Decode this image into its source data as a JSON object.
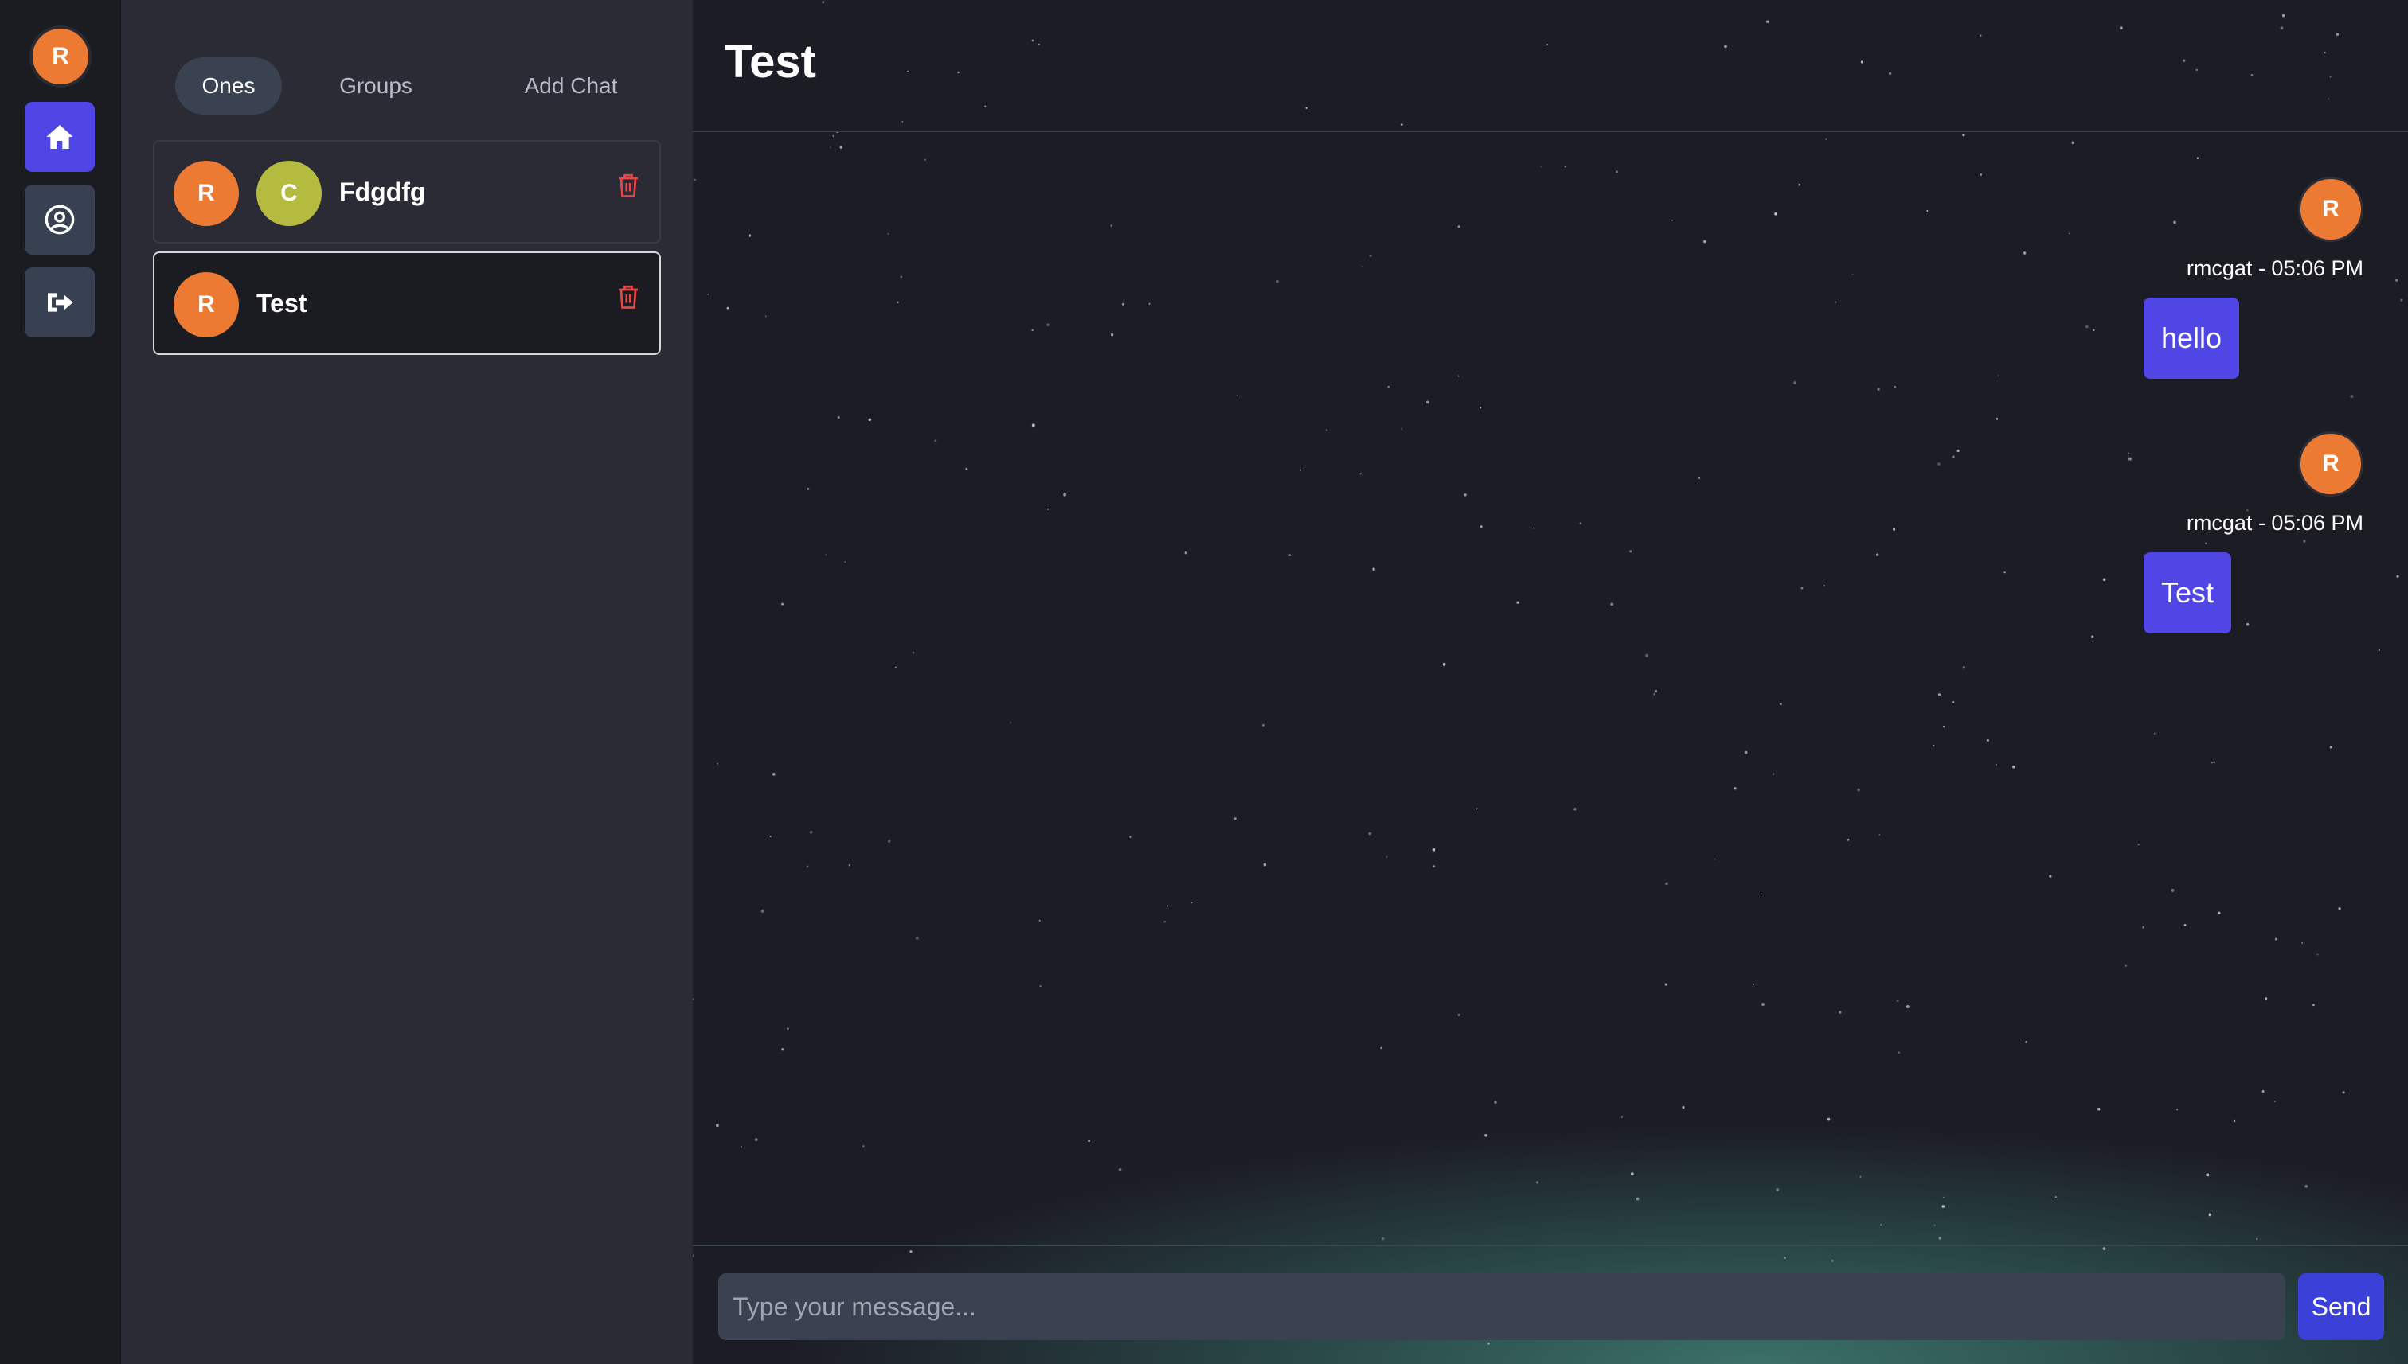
{
  "colors": {
    "accent": "#4f46e5",
    "avatar_orange": "#ed7a33",
    "avatar_olive": "#b5bb3f",
    "danger": "#ef4444",
    "send_button": "#3b40d8"
  },
  "rail": {
    "user_avatar_initial": "R",
    "buttons": [
      {
        "icon": "home-icon",
        "active": true
      },
      {
        "icon": "user-circle-icon",
        "active": false
      },
      {
        "icon": "logout-icon",
        "active": false
      }
    ]
  },
  "tabs": [
    {
      "label": "Ones",
      "active": true
    },
    {
      "label": "Groups",
      "active": false
    },
    {
      "label": "Add Chat",
      "active": false
    }
  ],
  "chats": [
    {
      "name": "Fdgdfg",
      "avatars": [
        "R",
        "C"
      ],
      "selected": false
    },
    {
      "name": "Test",
      "avatars": [
        "R"
      ],
      "selected": true
    }
  ],
  "conversation": {
    "title": "Test",
    "messages": [
      {
        "avatar": "R",
        "meta": "rmcgat - 05:06 PM",
        "text": "hello"
      },
      {
        "avatar": "R",
        "meta": "rmcgat - 05:06 PM",
        "text": "Test"
      }
    ]
  },
  "composer": {
    "placeholder": "Type your message...",
    "value": "",
    "send_label": "Send"
  }
}
